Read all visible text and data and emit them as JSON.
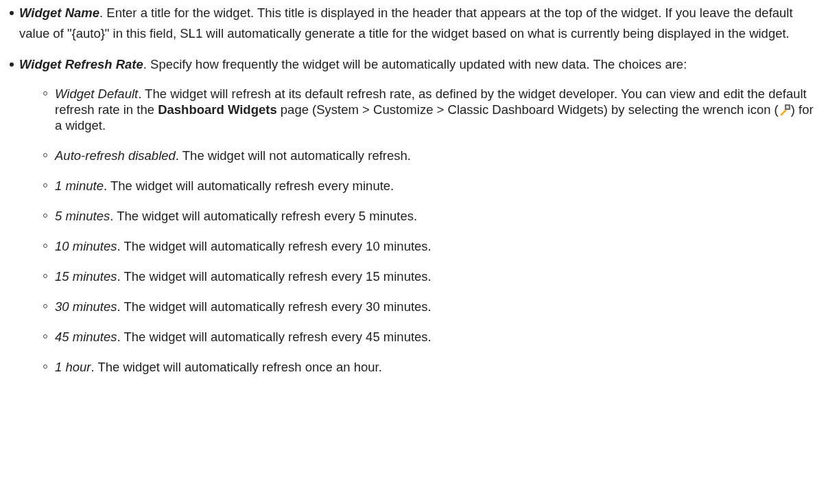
{
  "items": [
    {
      "term": "Widget Name",
      "text": ". Enter a title for the widget. This title is displayed in the header that appears at the top of the widget. If you leave the default value of \"{auto}\" in this field, SL1 will automatically generate a title for the widget based on what is currently being displayed in the widget."
    },
    {
      "term": "Widget Refresh Rate",
      "text": ". Specify how frequently the widget will be automatically updated with new data. The choices are:",
      "children": [
        {
          "term": "Widget Default",
          "text": ". The widget will refresh at its default refresh rate, as defined by the widget developer. You can view and edit the default refresh rate in the **Dashboard Widgets** page (System > Customize > Classic Dashboard Widgets) by selecting the wrench icon (",
          "text_after": ") for a widget."
        },
        {
          "term": "Auto-refresh disabled",
          "text": ". The widget will not automatically refresh."
        },
        {
          "term": "1 minute",
          "text": ". The widget will automatically refresh every minute."
        },
        {
          "term": "5 minutes",
          "text": ". The widget will automatically refresh every 5 minutes."
        },
        {
          "term": "10 minutes",
          "text": ". The widget will automatically refresh every 10 minutes."
        },
        {
          "term": "15 minutes",
          "text": ". The widget will automatically refresh every 15 minutes."
        },
        {
          "term": "30 minutes",
          "text": ". The widget will automatically refresh every 30 minutes."
        },
        {
          "term": "45 minutes",
          "text": ". The widget will automatically refresh every 45 minutes."
        },
        {
          "term": "1 hour",
          "text": ". The widget will automatically refresh once an hour."
        }
      ]
    }
  ]
}
